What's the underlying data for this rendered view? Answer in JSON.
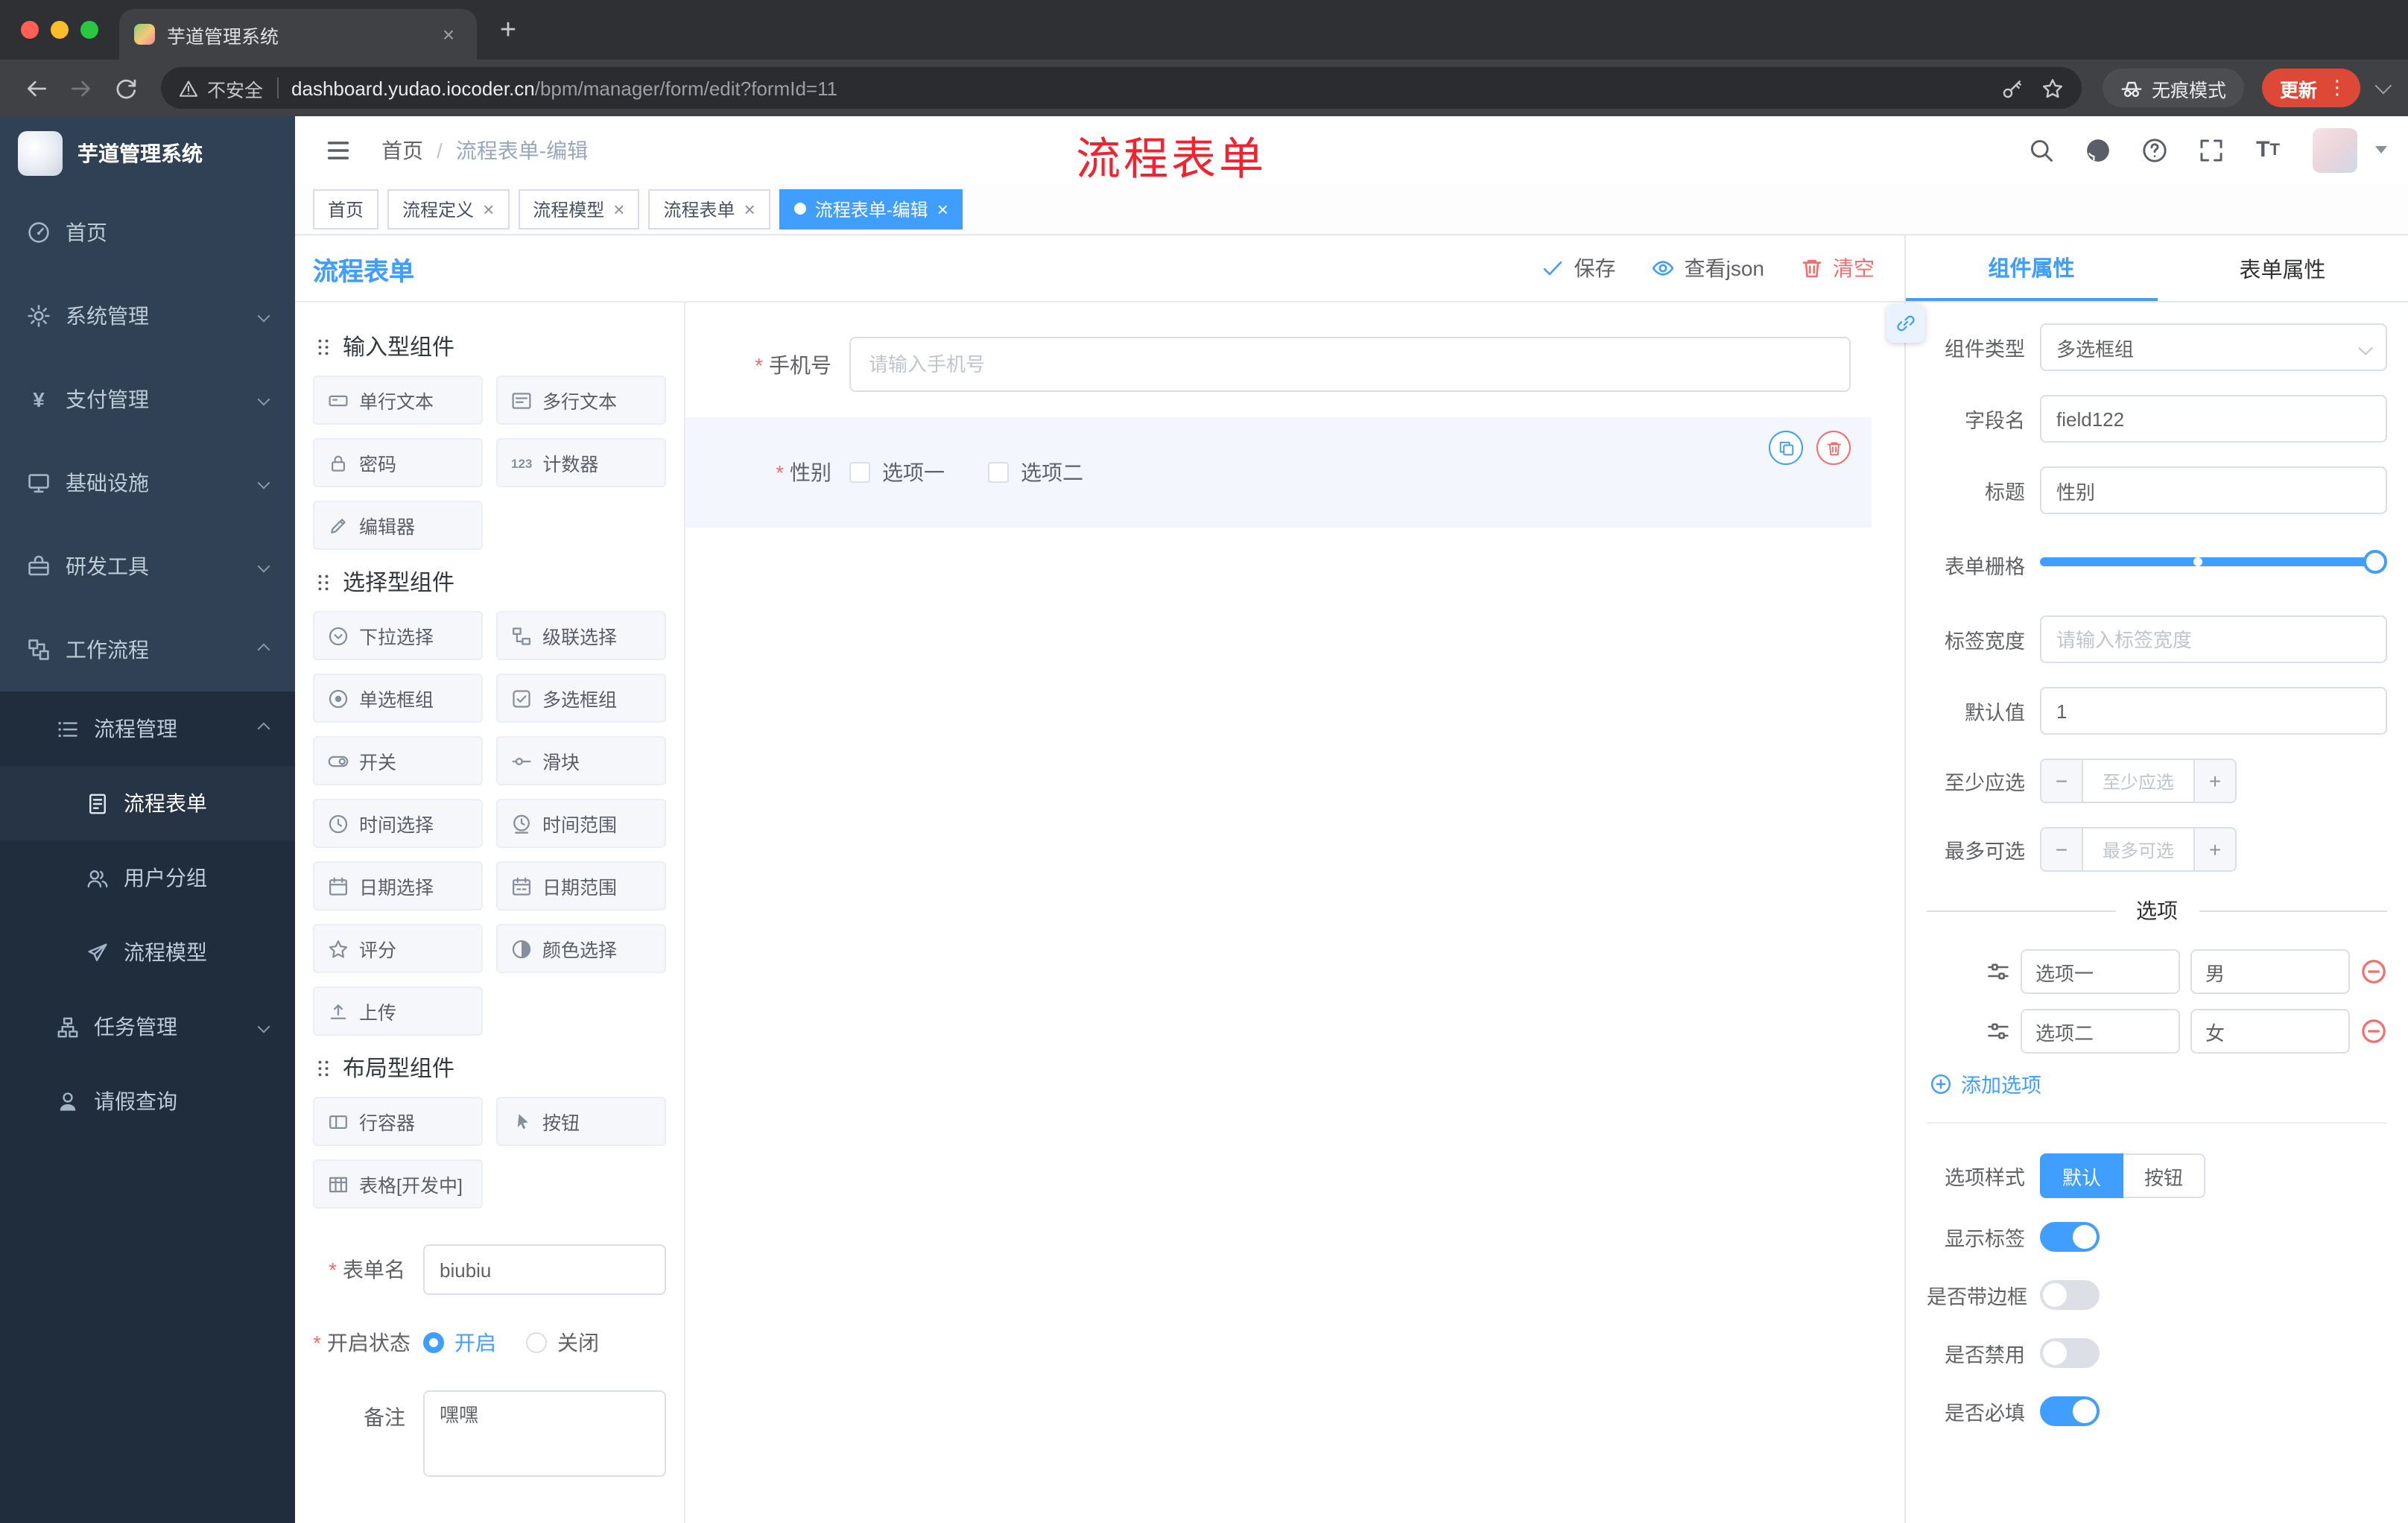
{
  "browser": {
    "tab_title": "芋道管理系统",
    "new_tab_label": "+",
    "security_label": "不安全",
    "url_host": "dashboard.yudao.iocoder.cn",
    "url_path": "/bpm/manager/form/edit?formId=11",
    "incognito_label": "无痕模式",
    "update_label": "更新"
  },
  "sidebar": {
    "logo_title": "芋道管理系统",
    "top_items": [
      {
        "label": "首页",
        "icon": "dashboard-icon"
      },
      {
        "label": "系统管理",
        "icon": "gear-icon"
      },
      {
        "label": "支付管理",
        "icon": "yen-icon"
      },
      {
        "label": "基础设施",
        "icon": "monitor-icon"
      },
      {
        "label": "研发工具",
        "icon": "toolbox-icon"
      },
      {
        "label": "工作流程",
        "icon": "workflow-icon"
      }
    ],
    "process_group": {
      "label": "流程管理",
      "icon": "list-icon"
    },
    "process_children": [
      {
        "label": "流程表单",
        "icon": "document-icon",
        "active": true
      },
      {
        "label": "用户分组",
        "icon": "users-icon"
      },
      {
        "label": "流程模型",
        "icon": "send-icon"
      }
    ],
    "task_item": {
      "label": "任务管理",
      "icon": "org-icon"
    },
    "leave_item": {
      "label": "请假查询",
      "icon": "user-icon"
    }
  },
  "header": {
    "breadcrumb_home": "首页",
    "breadcrumb_current": "流程表单-编辑",
    "overlay_title": "流程表单"
  },
  "tags": [
    {
      "label": "首页",
      "closable": false,
      "active": false
    },
    {
      "label": "流程定义",
      "closable": true,
      "active": false
    },
    {
      "label": "流程模型",
      "closable": true,
      "active": false
    },
    {
      "label": "流程表单",
      "closable": true,
      "active": false
    },
    {
      "label": "流程表单-编辑",
      "closable": true,
      "active": true
    }
  ],
  "designer": {
    "title": "流程表单",
    "save": "保存",
    "view_json": "查看json",
    "clear": "清空",
    "sections": [
      {
        "title": "输入型组件",
        "items": [
          {
            "label": "单行文本",
            "icon": "text-field-icon"
          },
          {
            "label": "多行文本",
            "icon": "textarea-icon"
          },
          {
            "label": "密码",
            "icon": "lock-icon"
          },
          {
            "label": "计数器",
            "icon": "counter-icon"
          },
          {
            "label": "编辑器",
            "icon": "pencil-icon"
          }
        ]
      },
      {
        "title": "选择型组件",
        "items": [
          {
            "label": "下拉选择",
            "icon": "dropdown-icon"
          },
          {
            "label": "级联选择",
            "icon": "cascade-icon"
          },
          {
            "label": "单选框组",
            "icon": "radio-icon"
          },
          {
            "label": "多选框组",
            "icon": "checkbox-icon"
          },
          {
            "label": "开关",
            "icon": "switch-icon"
          },
          {
            "label": "滑块",
            "icon": "slider-icon"
          },
          {
            "label": "时间选择",
            "icon": "clock-icon"
          },
          {
            "label": "时间范围",
            "icon": "clock-range-icon"
          },
          {
            "label": "日期选择",
            "icon": "calendar-icon"
          },
          {
            "label": "日期范围",
            "icon": "calendar-range-icon"
          },
          {
            "label": "评分",
            "icon": "star-icon"
          },
          {
            "label": "颜色选择",
            "icon": "color-icon"
          },
          {
            "label": "上传",
            "icon": "upload-icon"
          }
        ]
      },
      {
        "title": "布局型组件",
        "items": [
          {
            "label": "行容器",
            "icon": "row-container-icon"
          },
          {
            "label": "按钮",
            "icon": "button-icon"
          },
          {
            "label": "表格[开发中]",
            "icon": "table-icon"
          }
        ]
      }
    ],
    "meta": {
      "name_label": "表单名",
      "name_value": "biubiu",
      "status_label": "开启状态",
      "status_on": "开启",
      "status_off": "关闭",
      "remark_label": "备注",
      "remark_value": "嘿嘿"
    },
    "canvas": {
      "phone_label": "手机号",
      "phone_placeholder": "请输入手机号",
      "gender_label": "性别",
      "gender_option1": "选项一",
      "gender_option2": "选项二"
    }
  },
  "panel": {
    "tab_component": "组件属性",
    "tab_form": "表单属性",
    "component_type_label": "组件类型",
    "component_type_value": "多选框组",
    "field_label": "字段名",
    "field_value": "field122",
    "title_label": "标题",
    "title_value": "性别",
    "grid_label": "表单栅格",
    "grid_value": 24,
    "grid_max": 24,
    "label_width_label": "标签宽度",
    "label_width_placeholder": "请输入标签宽度",
    "default_label": "默认值",
    "default_value": "1",
    "min_label": "至少应选",
    "min_placeholder": "至少应选",
    "max_label": "最多可选",
    "max_placeholder": "最多可选",
    "options_title": "选项",
    "options": [
      {
        "label": "选项一",
        "value": "男"
      },
      {
        "label": "选项二",
        "value": "女"
      }
    ],
    "add_option": "添加选项",
    "style_label": "选项样式",
    "style_default": "默认",
    "style_button": "按钮",
    "toggles": [
      {
        "label": "显示标签",
        "on": true
      },
      {
        "label": "是否带边框",
        "on": false
      },
      {
        "label": "是否禁用",
        "on": false
      },
      {
        "label": "是否必填",
        "on": true
      }
    ]
  },
  "colors": {
    "accent": "#409eff",
    "danger": "#f56c6c",
    "sidebar": "#304156",
    "update_badge": "#de4837"
  }
}
